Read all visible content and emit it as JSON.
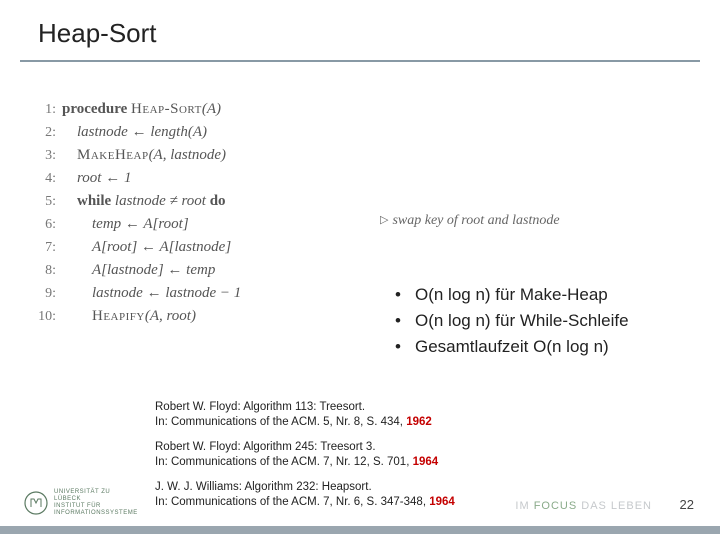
{
  "title": "Heap-Sort",
  "code": {
    "lines": [
      {
        "n": "1:",
        "indent": 0,
        "kw": "procedure ",
        "sc": "Heap-Sort",
        "rest": "(A)"
      },
      {
        "n": "2:",
        "indent": 1,
        "it": "lastnode ← length",
        "rest": "(A)"
      },
      {
        "n": "3:",
        "indent": 1,
        "sc": "MakeHeap",
        "rest": "(A, lastnode)"
      },
      {
        "n": "4:",
        "indent": 1,
        "it": "root ← 1"
      },
      {
        "n": "5:",
        "indent": 1,
        "kw": "while ",
        "it": "lastnode ≠ root",
        "kw2": " do"
      },
      {
        "n": "6:",
        "indent": 2,
        "it": "temp ← A[root]"
      },
      {
        "n": "7:",
        "indent": 2,
        "it": "A[root] ← A[lastnode]"
      },
      {
        "n": "8:",
        "indent": 2,
        "it": "A[lastnode] ← temp"
      },
      {
        "n": "9:",
        "indent": 2,
        "it": "lastnode ← lastnode − 1"
      },
      {
        "n": "10:",
        "indent": 2,
        "sc": "Heapify",
        "rest": "(A, root)"
      }
    ],
    "comment": "swap key of root and lastnode"
  },
  "bullets": [
    "O(n log n) für Make-Heap",
    "O(n log n) für While-Schleife",
    "Gesamtlaufzeit O(n log n)"
  ],
  "refs": [
    {
      "title": "Robert W. Floyd: Algorithm 113: Treesort.",
      "pub": "In: Communications of the ACM. 5, Nr. 8, S. 434, ",
      "year": "1962"
    },
    {
      "title": "Robert W. Floyd: Algorithm 245: Treesort 3.",
      "pub": "In: Communications of the ACM. 7, Nr. 12, S. 701, ",
      "year": "1964"
    },
    {
      "title": "J. W. J. Williams: Algorithm 232: Heapsort.",
      "pub": "In: Communications of the ACM. 7, Nr. 6, S. 347-348, ",
      "year": "1964"
    }
  ],
  "footer": {
    "logo_line1": "UNIVERSITÄT ZU LÜBECK",
    "logo_line2": "INSTITUT FÜR INFORMATIONSSYSTEME",
    "tagline_pre": "IM ",
    "tagline_focus": "FOCUS",
    "tagline_post": " DAS LEBEN",
    "page": "22"
  }
}
